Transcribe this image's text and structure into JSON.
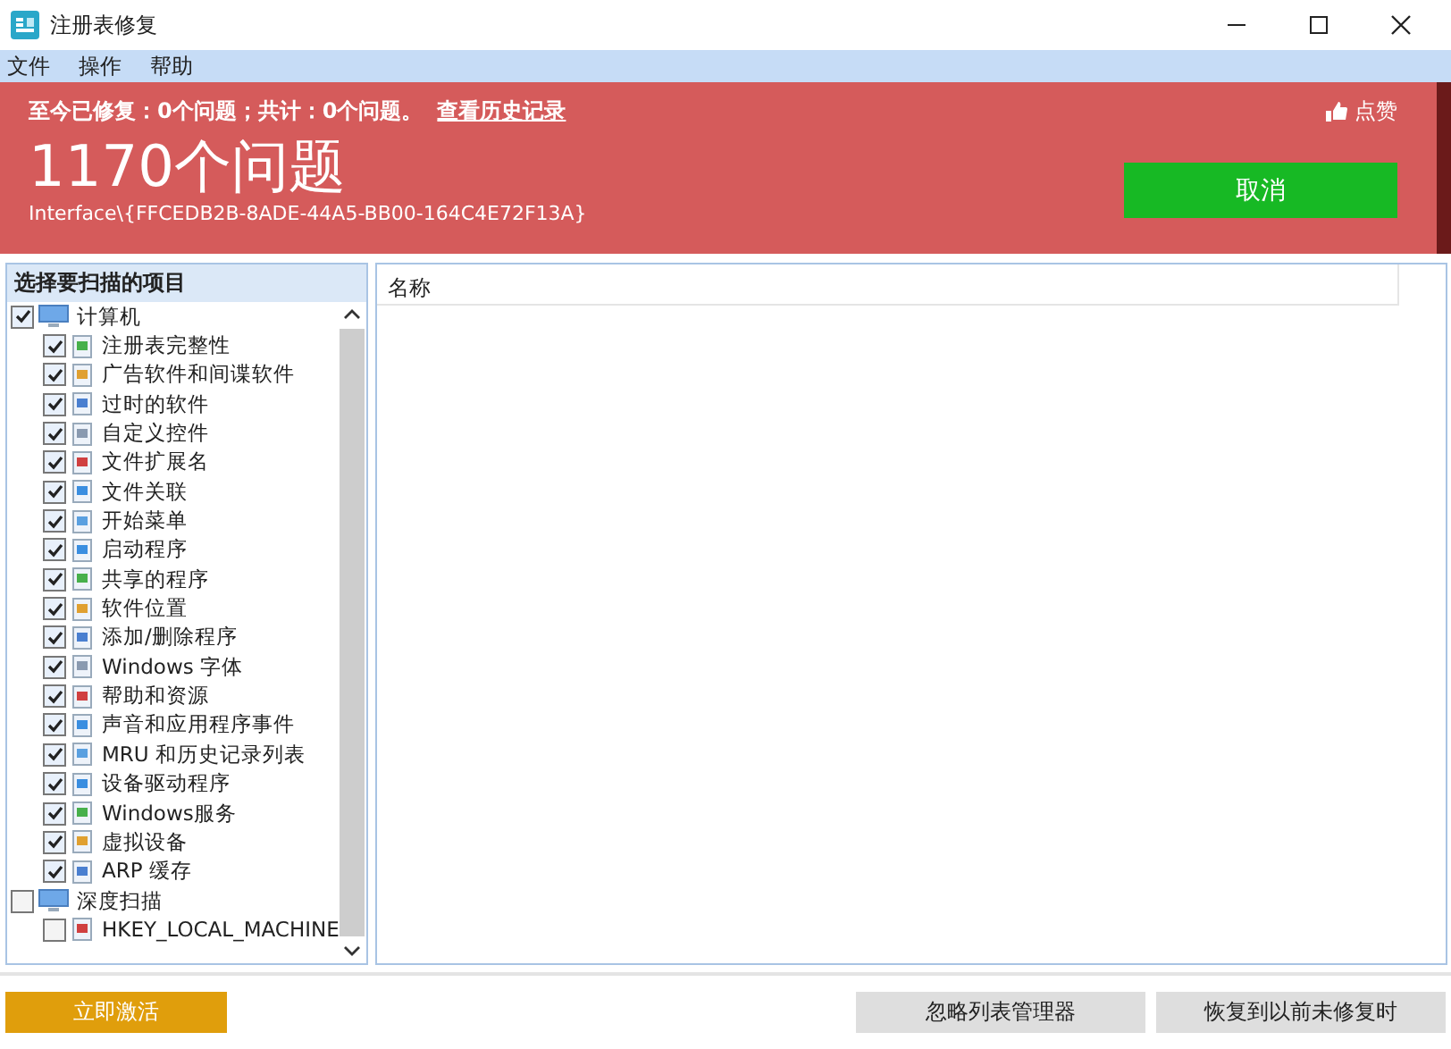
{
  "window": {
    "title": "注册表修复"
  },
  "menu": [
    "文件",
    "操作",
    "帮助"
  ],
  "header": {
    "summary": "至今已修复：0个问题；共计：0个问题。",
    "history_link": "查看历史记录",
    "count": "1170个问题",
    "current_key": "Interface\\{FFCEDB2B-8ADE-44A5-BB00-164C4E72F13A}",
    "like": "点赞",
    "cancel": "取消"
  },
  "scan_panel": {
    "title": "选择要扫描的项目",
    "tree": [
      {
        "label": "计算机",
        "checked": true,
        "children": [
          {
            "label": "注册表完整性",
            "checked": true
          },
          {
            "label": "广告软件和间谍软件",
            "checked": true
          },
          {
            "label": "过时的软件",
            "checked": true
          },
          {
            "label": "自定义控件",
            "checked": true
          },
          {
            "label": "文件扩展名",
            "checked": true
          },
          {
            "label": "文件关联",
            "checked": true
          },
          {
            "label": "开始菜单",
            "checked": true
          },
          {
            "label": "启动程序",
            "checked": true
          },
          {
            "label": "共享的程序",
            "checked": true
          },
          {
            "label": "软件位置",
            "checked": true
          },
          {
            "label": "添加/删除程序",
            "checked": true
          },
          {
            "label": "Windows 字体",
            "checked": true
          },
          {
            "label": "帮助和资源",
            "checked": true
          },
          {
            "label": "声音和应用程序事件",
            "checked": true
          },
          {
            "label": "MRU 和历史记录列表",
            "checked": true
          },
          {
            "label": "设备驱动程序",
            "checked": true
          },
          {
            "label": "Windows服务",
            "checked": true
          },
          {
            "label": "虚拟设备",
            "checked": true
          },
          {
            "label": "ARP 缓存",
            "checked": true
          }
        ]
      },
      {
        "label": "深度扫描",
        "checked": false,
        "children": [
          {
            "label": "HKEY_LOCAL_MACHINE",
            "checked": false
          }
        ]
      }
    ]
  },
  "results": {
    "columns": [
      "名称"
    ]
  },
  "buttons": {
    "activate": "立即激活",
    "ignore_list": "忽略列表管理器",
    "restore": "恢复到以前未修复时"
  }
}
